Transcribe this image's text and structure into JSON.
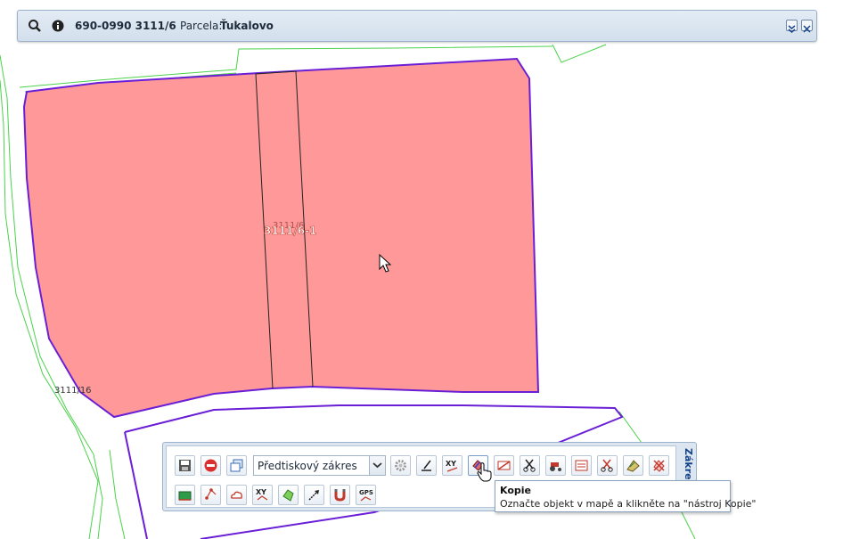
{
  "header": {
    "parcel_code": "690-0990 3111/6",
    "parcel_label": "Parcela:",
    "parcel_name": "Ťukalovo",
    "icons": [
      "search-icon",
      "info-icon",
      "collapse-icon",
      "close-icon"
    ]
  },
  "map": {
    "parcel_label_main": "3111/6-1",
    "parcel_label_faint": "3111/6",
    "parcel_label_corner": "3111/16",
    "colors": {
      "parcel_fill": "#ff9999",
      "parcel_border": "#6a1fd6",
      "boundary_lines": "#4ad24a",
      "strip_lines": "#222222"
    }
  },
  "toolbar": {
    "title": "Zákres",
    "layer_select_value": "Předtiskový zákres",
    "row1_tools": [
      "save-icon",
      "stop-icon",
      "windows-icon",
      "dropdown",
      "settings-icon",
      "draw-line-icon",
      "xy-icon",
      "copy-icon",
      "delete-line-icon",
      "cut-icon",
      "tractor-icon",
      "edit-area-icon",
      "scissors-icon",
      "hatch-icon",
      "remove-icon"
    ],
    "row2_tools": [
      "area-icon",
      "point-icon",
      "cloud-icon",
      "xy-draw-icon",
      "polygon-icon",
      "arrow-icon",
      "magnet-icon",
      "gps-icon"
    ]
  },
  "tooltip": {
    "title": "Kopie",
    "text": "Označte objekt v mapě a klikněte na \"nástroj Kopie\""
  }
}
